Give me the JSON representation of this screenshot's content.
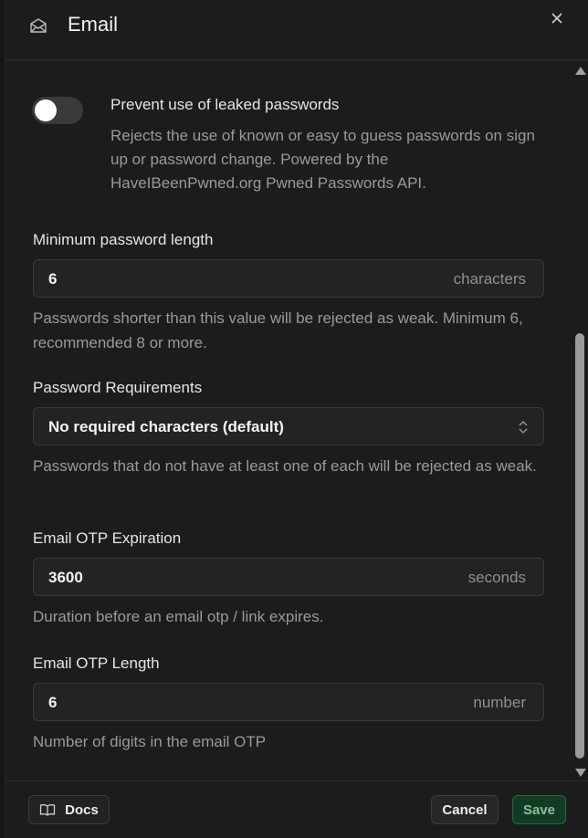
{
  "header": {
    "title": "Email",
    "icon": "mail-open-icon",
    "close_icon": "close-icon"
  },
  "leaked_passwords": {
    "enabled": false,
    "title": "Prevent use of leaked passwords",
    "description": "Rejects the use of known or easy to guess passwords on sign up or password change. Powered by the HaveIBeenPwned.org Pwned Passwords API."
  },
  "min_password_length": {
    "label": "Minimum password length",
    "value": "6",
    "unit": "characters",
    "help": "Passwords shorter than this value will be rejected as weak. Minimum 6, recommended 8 or more."
  },
  "password_requirements": {
    "label": "Password Requirements",
    "selected": "No required characters (default)",
    "help": "Passwords that do not have at least one of each will be rejected as weak."
  },
  "email_otp_expiration": {
    "label": "Email OTP Expiration",
    "value": "3600",
    "unit": "seconds",
    "help": "Duration before an email otp / link expires."
  },
  "email_otp_length": {
    "label": "Email OTP Length",
    "value": "6",
    "unit": "number",
    "help": "Number of digits in the email OTP"
  },
  "footer": {
    "docs_label": "Docs",
    "cancel_label": "Cancel",
    "save_label": "Save"
  },
  "colors": {
    "background": "#1c1c1c",
    "save_bg": "#133b24",
    "save_text": "#8bbd9c"
  }
}
